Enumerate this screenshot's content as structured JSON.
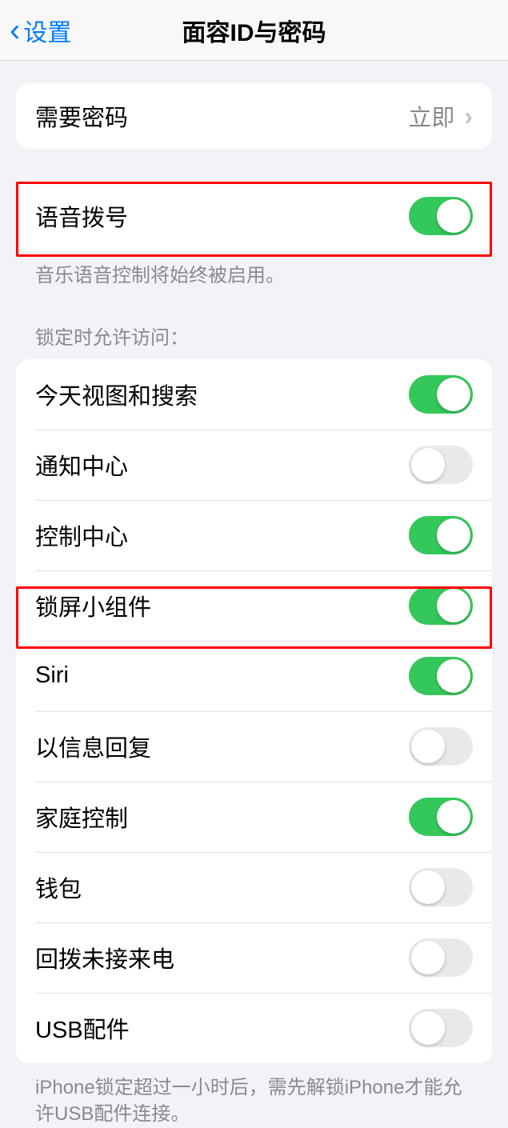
{
  "nav": {
    "back_label": "设置",
    "title": "面容ID与密码"
  },
  "require_passcode": {
    "label": "需要密码",
    "value": "立即"
  },
  "voice_dial": {
    "label": "语音拨号",
    "on": true,
    "footer": "音乐语音控制将始终被启用。"
  },
  "allow_access_header": "锁定时允许访问：",
  "allow_access": [
    {
      "label": "今天视图和搜索",
      "on": true
    },
    {
      "label": "通知中心",
      "on": false
    },
    {
      "label": "控制中心",
      "on": true
    },
    {
      "label": "锁屏小组件",
      "on": true
    },
    {
      "label": "Siri",
      "on": true
    },
    {
      "label": "以信息回复",
      "on": false
    },
    {
      "label": "家庭控制",
      "on": true
    },
    {
      "label": "钱包",
      "on": false
    },
    {
      "label": "回拨未接来电",
      "on": false
    },
    {
      "label": "USB配件",
      "on": false
    }
  ],
  "usb_footer": "iPhone锁定超过一小时后，需先解锁iPhone才能允许USB配件连接。"
}
